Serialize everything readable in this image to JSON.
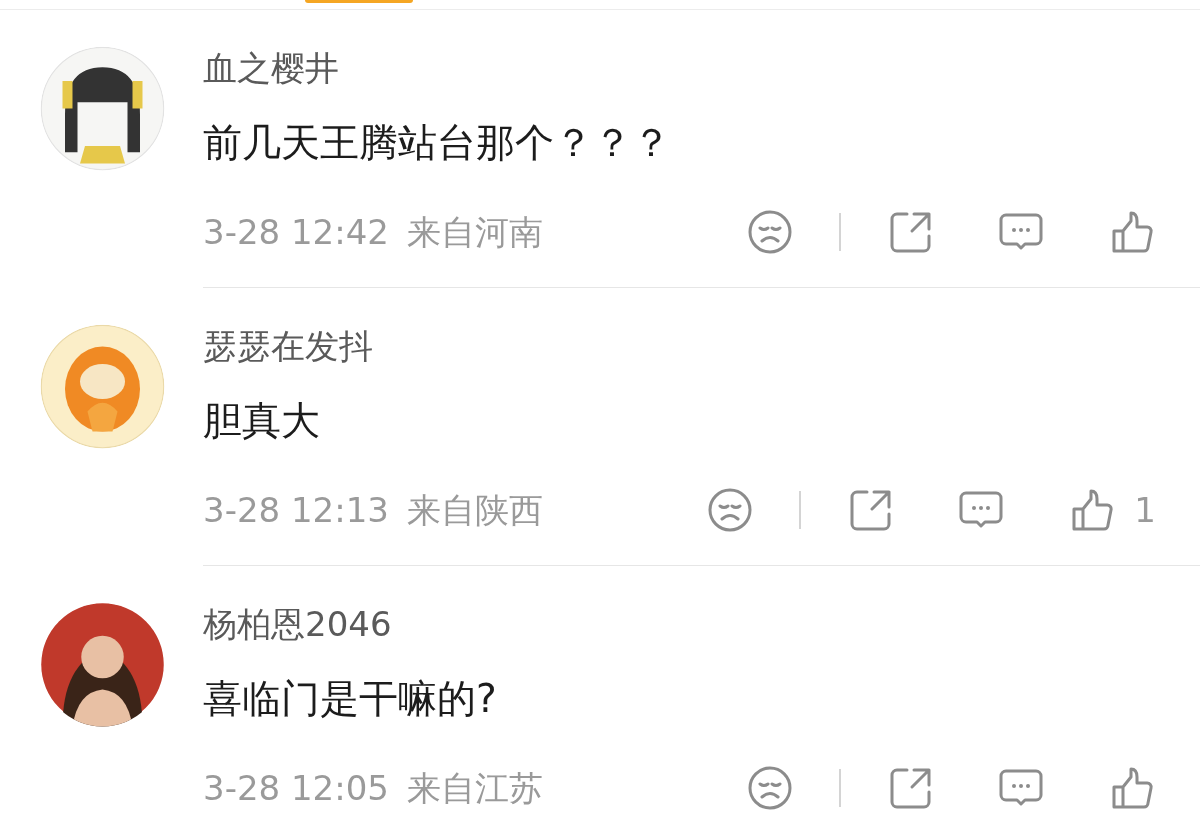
{
  "comments": [
    {
      "avatar": {
        "kind": "cartoon"
      },
      "name": "血之樱井",
      "text": "前几天王腾站台那个？？？",
      "time": "3-28 12:42",
      "location": "来自河南"
    },
    {
      "avatar": {
        "kind": "mascot"
      },
      "name": "瑟瑟在发抖",
      "text": "胆真大",
      "time": "3-28 12:13",
      "location": "来自陕西",
      "like_count": "1"
    },
    {
      "avatar": {
        "kind": "person"
      },
      "name": "杨柏恩2046",
      "text": "喜临门是干嘛的?",
      "time": "3-28 12:05",
      "location": "来自江苏"
    }
  ]
}
